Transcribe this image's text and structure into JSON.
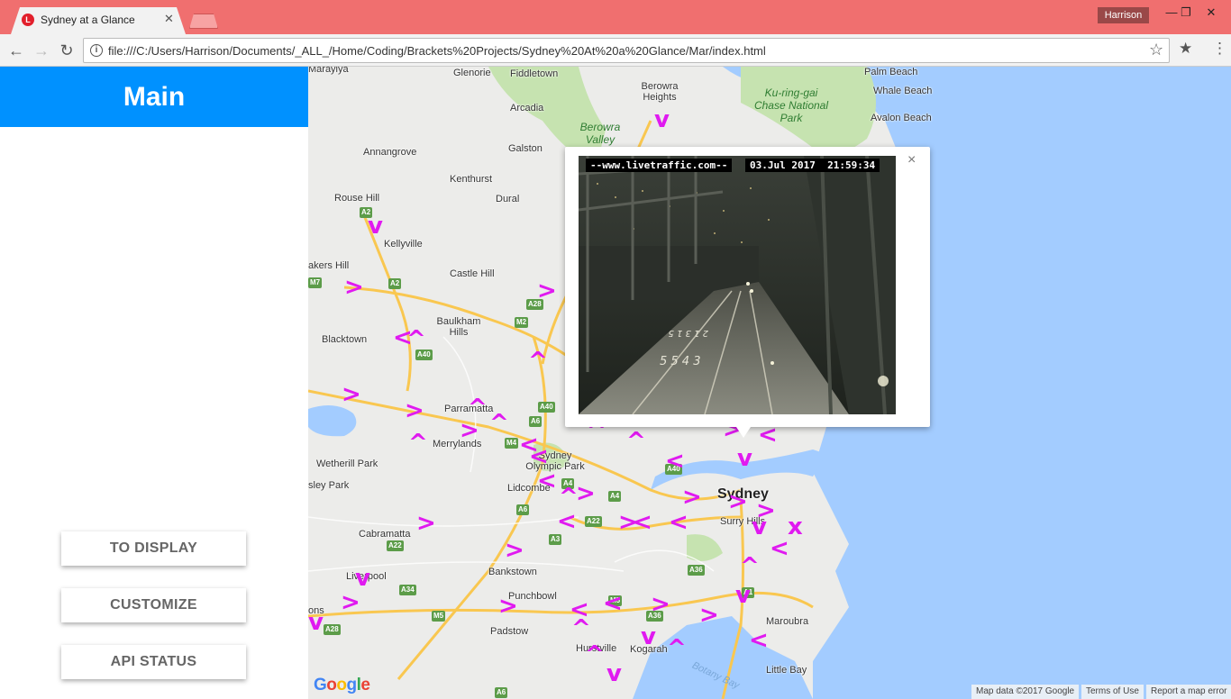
{
  "browser": {
    "tab_title": "Sydney at a Glance",
    "tab_favicon": "L",
    "profile": "Harrison",
    "url": "file:///C:/Users/Harrison/Documents/_ALL_/Home/Coding/Brackets%20Projects/Sydney%20At%20a%20Glance/Mar/index.html",
    "icons": [
      "back-icon",
      "forward-icon",
      "reload-icon",
      "info-icon",
      "star-icon",
      "bookmark-star-icon",
      "menu-icon"
    ]
  },
  "sidebar": {
    "title": "Main",
    "buttons": [
      {
        "label": "TO DISPLAY"
      },
      {
        "label": "CUSTOMIZE"
      },
      {
        "label": "API STATUS"
      }
    ],
    "accent_color": "#0091ff"
  },
  "map": {
    "places": [
      "Marayiya",
      "Glenorie",
      "Fiddletown",
      "Berowra Heights",
      "Palm Beach",
      "Whale Beach",
      "Ku-ring-gai Chase National Park",
      "Avalon Beach",
      "Arcadia",
      "Berowra Valley",
      "Annangrove",
      "Galston",
      "Kenthurst",
      "Dural",
      "Rouse Hill",
      "Kellyville",
      "akers Hill",
      "Castle Hill",
      "Baulkham Hills",
      "Blacktown",
      "Parramatta",
      "Merrylands",
      "Wetherill Park",
      "sley Park",
      "Sydney Olympic Park",
      "Lidcombe",
      "Sydney",
      "Surry Hills",
      "Cabramatta",
      "Liverpool",
      "Bankstown",
      "Punchbowl",
      "Padstow",
      "Hurstville",
      "Kogarah",
      "Maroubra",
      "Little Bay",
      "Botany Bay",
      "ons"
    ],
    "road_shields": [
      "A2",
      "A2",
      "M7",
      "A28",
      "M2",
      "A40",
      "A40",
      "A6",
      "M4",
      "A4",
      "A40",
      "A4",
      "A22",
      "A6",
      "A3",
      "A22",
      "A34",
      "M5",
      "M5",
      "A36",
      "A36",
      "A1",
      "A28",
      "A6"
    ],
    "camera_marker_color": "#e01af0",
    "google_logo": "Google",
    "attribution": [
      "Map data ©2017 Google",
      "Terms of Use",
      "Report a map error"
    ]
  },
  "info_window": {
    "banner_left": "--www.livetraffic.com--",
    "banner_right": "03.Jul 2017  21:59:34",
    "close_glyph": "×"
  }
}
